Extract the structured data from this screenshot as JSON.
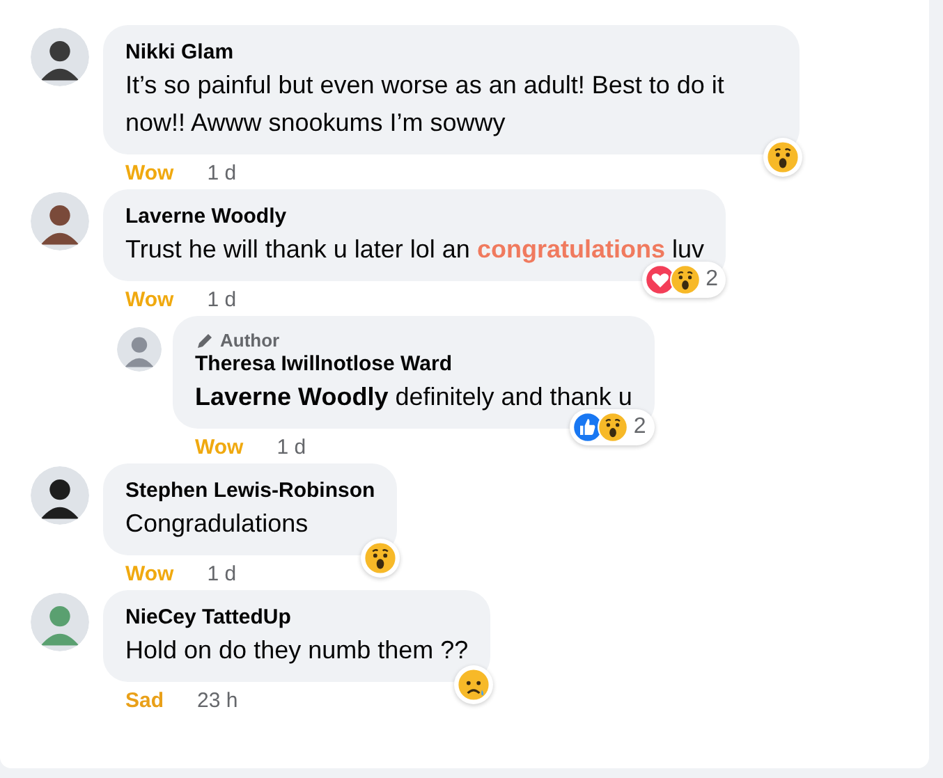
{
  "comments": [
    {
      "name": "Nikki Glam",
      "text": [
        {
          "kind": "plain",
          "text": "It’s so painful but even worse as an adult! Best to do it now!! Awww snookums I’m sowwy"
        }
      ],
      "reactions": [
        {
          "kind": "wow"
        }
      ],
      "my_reaction": {
        "kind": "wow",
        "label": "Wow"
      },
      "time": "1 d"
    },
    {
      "name": "Laverne Woodly",
      "text": [
        {
          "kind": "plain",
          "text": "Trust he will thank u later lol an "
        },
        {
          "kind": "effect",
          "text": "congratulations"
        },
        {
          "kind": "plain",
          "text": " luv"
        }
      ],
      "reactions": [
        {
          "kind": "love"
        },
        {
          "kind": "wow"
        }
      ],
      "reaction_count": "2",
      "my_reaction": {
        "kind": "wow",
        "label": "Wow"
      },
      "time": "1 d",
      "replies": [
        {
          "badge": "Author",
          "name": "Theresa Iwillnotlose Ward",
          "text": [
            {
              "kind": "mention",
              "text": "Laverne Woodly"
            },
            {
              "kind": "plain",
              "text": " definitely and thank u"
            }
          ],
          "reactions": [
            {
              "kind": "like"
            },
            {
              "kind": "wow"
            }
          ],
          "reaction_count": "2",
          "my_reaction": {
            "kind": "wow",
            "label": "Wow"
          },
          "time": "1 d"
        }
      ]
    },
    {
      "name": "Stephen Lewis-Robinson",
      "text": [
        {
          "kind": "plain",
          "text": "Congradulations"
        }
      ],
      "reactions": [
        {
          "kind": "wow"
        }
      ],
      "my_reaction": {
        "kind": "wow",
        "label": "Wow"
      },
      "time": "1 d"
    },
    {
      "name": "NieCey TattedUp",
      "text": [
        {
          "kind": "plain",
          "text": "Hold on do they numb them ??"
        }
      ],
      "reactions": [
        {
          "kind": "sad"
        }
      ],
      "my_reaction": {
        "kind": "sad",
        "label": "Sad"
      },
      "time": "23 h"
    }
  ]
}
